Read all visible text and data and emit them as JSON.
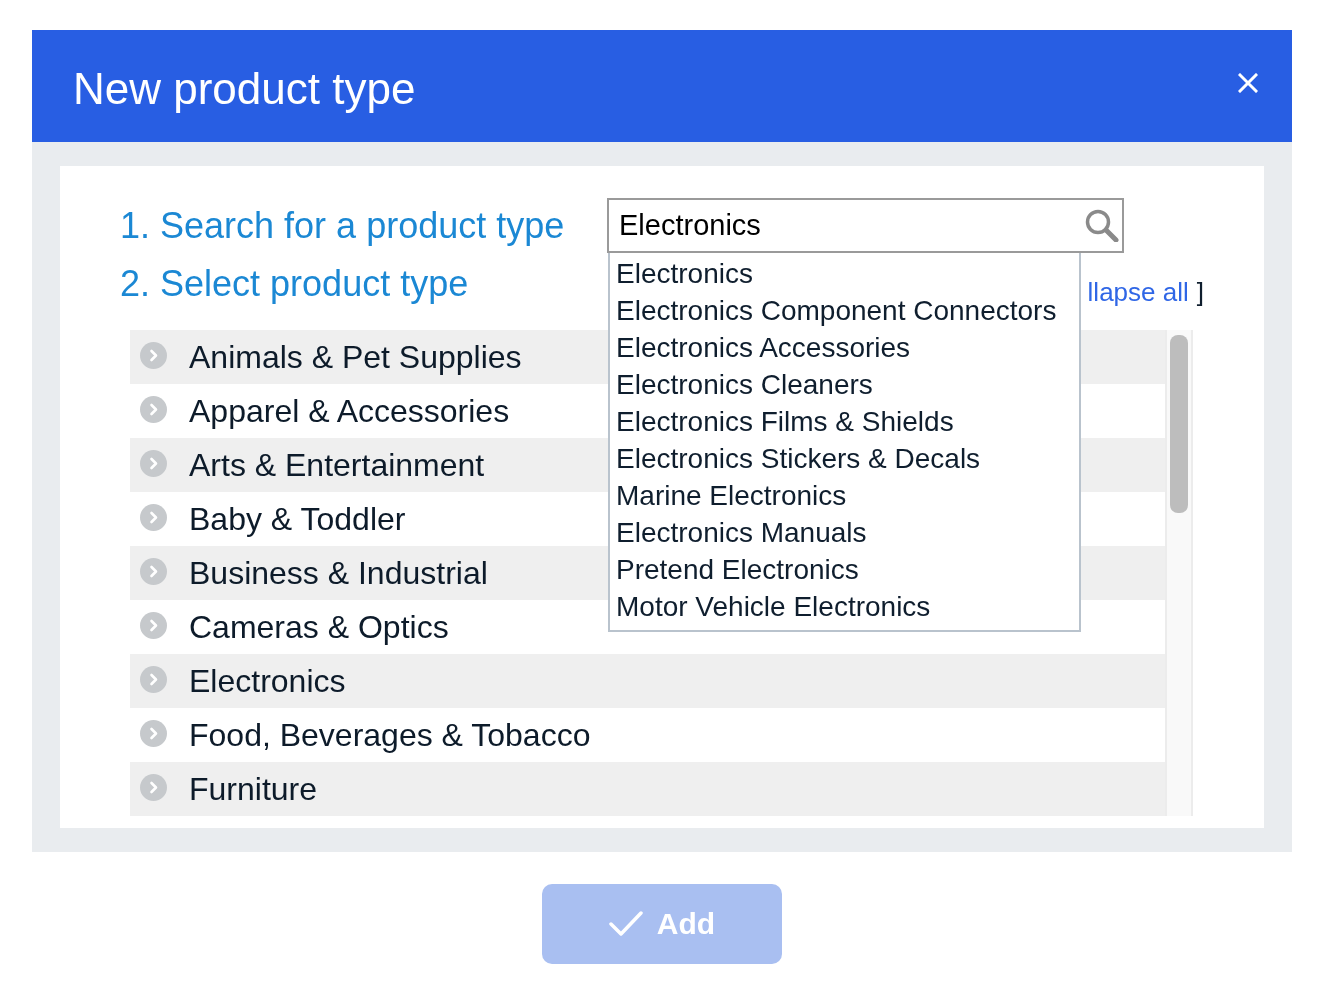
{
  "dialog": {
    "title": "New product type"
  },
  "search": {
    "label": "1. Search for a product type",
    "value": "Electronics"
  },
  "select": {
    "label": "2. Select product type",
    "tree_controls": [
      {
        "kind": "link",
        "text": "llapse all"
      },
      {
        "kind": "text",
        "text": "]"
      }
    ]
  },
  "suggestions": [
    {
      "text": "Electronics",
      "selected": false
    },
    {
      "text": "Electronics Component Connectors",
      "selected": false
    },
    {
      "text": "Electronics Accessories",
      "selected": false
    },
    {
      "text": "Electronics Cleaners",
      "selected": false
    },
    {
      "text": "Electronics Films & Shields",
      "selected": false
    },
    {
      "text": "Electronics Stickers & Decals",
      "selected": false
    },
    {
      "text": "Marine Electronics",
      "selected": false
    },
    {
      "text": "Electronics Manuals",
      "selected": false
    },
    {
      "text": "Pretend Electronics",
      "selected": false
    },
    {
      "text": "Motor Vehicle Electronics",
      "selected": false
    }
  ],
  "categories": [
    {
      "label": "Animals & Pet Supplies",
      "expanded": false,
      "selected": false
    },
    {
      "label": "Apparel & Accessories",
      "expanded": false,
      "selected": false
    },
    {
      "label": "Arts & Entertainment",
      "expanded": false,
      "selected": false
    },
    {
      "label": "Baby & Toddler",
      "expanded": false,
      "selected": false
    },
    {
      "label": "Business & Industrial",
      "expanded": false,
      "selected": false
    },
    {
      "label": "Cameras & Optics",
      "expanded": false,
      "selected": false
    },
    {
      "label": "Electronics",
      "expanded": false,
      "selected": false
    },
    {
      "label": "Food, Beverages & Tobacco",
      "expanded": false,
      "selected": false
    },
    {
      "label": "Furniture",
      "expanded": false,
      "selected": false
    }
  ],
  "add_button": {
    "label": "Add",
    "disabled": true
  }
}
